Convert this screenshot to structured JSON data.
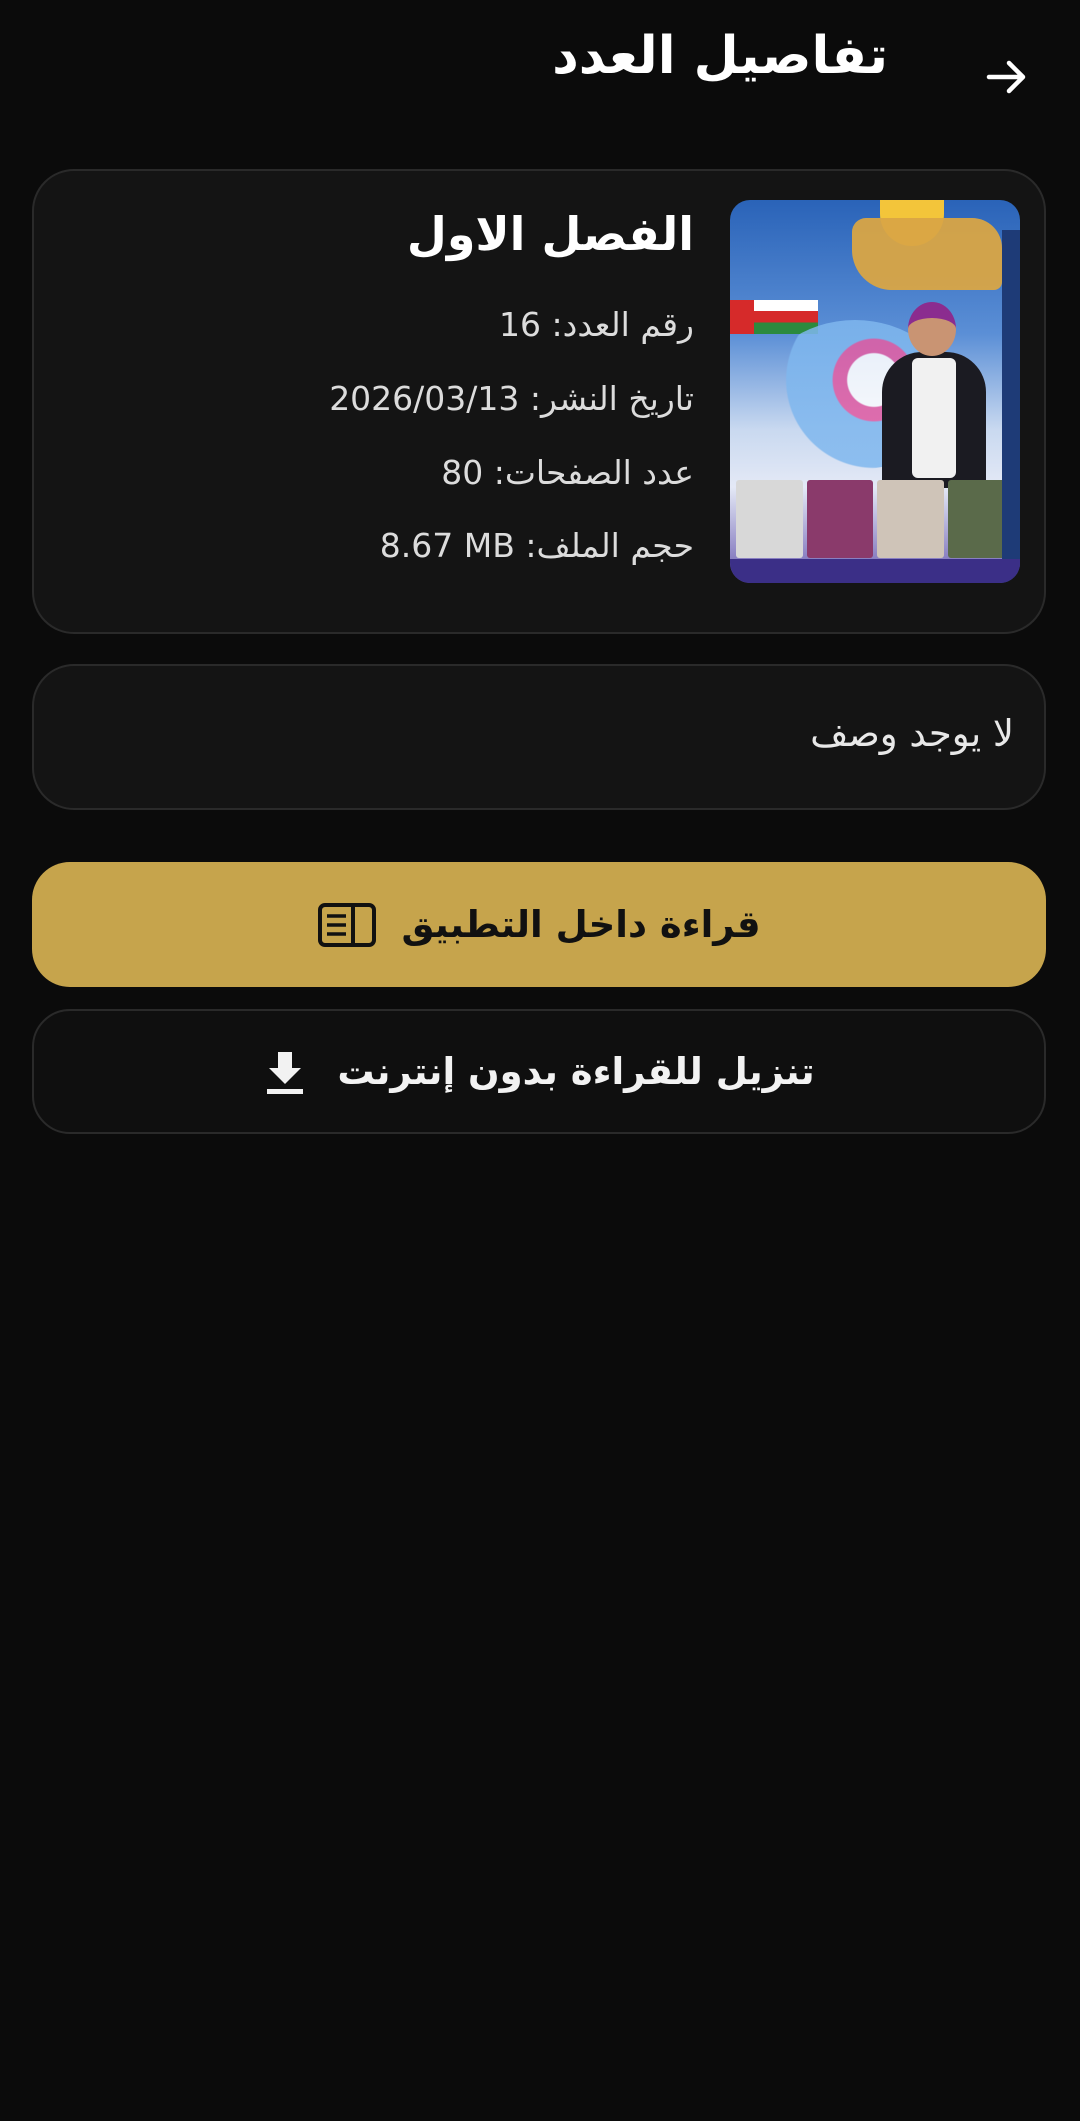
{
  "header": {
    "title": "تفاصيل العدد",
    "back_icon": "arrow-right-icon"
  },
  "issue": {
    "title": "الفصل الاول",
    "cover_image": "magazine-cover",
    "issue_number": {
      "label": "رقم العدد:",
      "value": "16"
    },
    "publish_date": {
      "label": "تاريخ النشر:",
      "value": "2026/03/13"
    },
    "page_count": {
      "label": "عدد الصفحات:",
      "value": "80"
    },
    "file_size": {
      "label": "حجم الملف:",
      "value": "8.67 MB"
    }
  },
  "description": {
    "text": "لا يوجد وصف"
  },
  "actions": {
    "read_label": "قراءة داخل التطبيق",
    "read_icon": "reader-mode-icon",
    "download_label": "تنزيل للقراءة بدون إنترنت",
    "download_icon": "download-icon"
  },
  "colors": {
    "background": "#0b0b0b",
    "card": "#141414",
    "accent_gold": "#c6a44c",
    "border": "#2a2a2a"
  }
}
